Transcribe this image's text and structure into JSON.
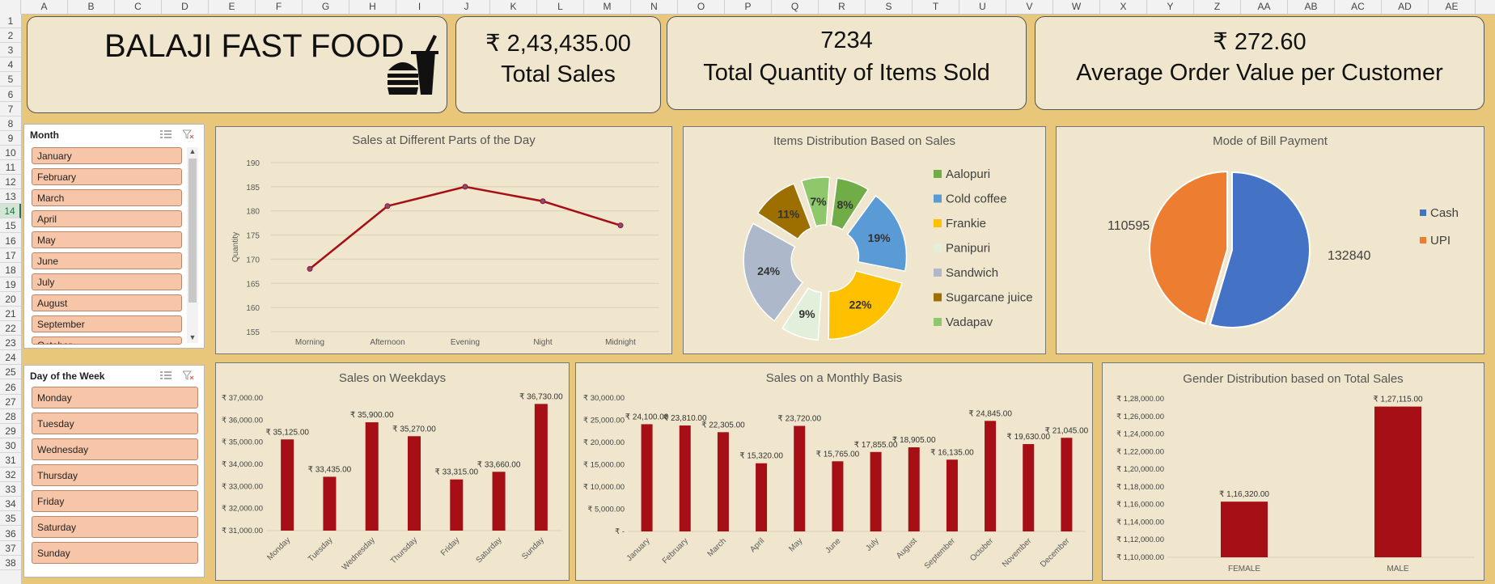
{
  "columns": [
    "A",
    "B",
    "C",
    "D",
    "E",
    "F",
    "G",
    "H",
    "I",
    "J",
    "K",
    "L",
    "M",
    "N",
    "O",
    "P",
    "Q",
    "R",
    "S",
    "T",
    "U",
    "V",
    "W",
    "X",
    "Y",
    "Z",
    "AA",
    "AB",
    "AC",
    "AD",
    "AE"
  ],
  "rows": [
    "1",
    "2",
    "3",
    "4",
    "5",
    "6",
    "7",
    "8",
    "9",
    "10",
    "11",
    "12",
    "13",
    "14",
    "15",
    "16",
    "17",
    "18",
    "19",
    "20",
    "21",
    "22",
    "23",
    "24",
    "25",
    "26",
    "27",
    "28",
    "29",
    "30",
    "31",
    "32",
    "33",
    "34",
    "35",
    "36",
    "37",
    "38"
  ],
  "kpis": {
    "title": "BALAJI FAST FOOD",
    "total_sales_value": "₹ 2,43,435.00",
    "total_sales_label": "Total Sales",
    "qty_value": "7234",
    "qty_label": "Total Quantity of Items Sold",
    "aov_value": "₹ 272.60",
    "aov_label": "Average Order Value per Customer"
  },
  "month_slicer": {
    "title": "Month",
    "items": [
      "January",
      "February",
      "March",
      "April",
      "May",
      "June",
      "July",
      "August",
      "September",
      "October"
    ]
  },
  "day_slicer": {
    "title": "Day of the Week",
    "items": [
      "Monday",
      "Tuesday",
      "Wednesday",
      "Thursday",
      "Friday",
      "Saturday",
      "Sunday"
    ]
  },
  "chart_data": [
    {
      "type": "line",
      "title": "Sales at Different Parts of the Day",
      "ylabel": "Quantity",
      "categories": [
        "Morning",
        "Afternoon",
        "Evening",
        "Night",
        "Midnight"
      ],
      "values": [
        168,
        181,
        185,
        182,
        177
      ],
      "ylim": [
        155,
        190
      ],
      "yticks": [
        "155",
        "160",
        "165",
        "170",
        "175",
        "180",
        "185",
        "190"
      ],
      "color": "#a50f15"
    },
    {
      "type": "pie",
      "title": "Items Distribution Based on Sales",
      "labels": [
        "Aalopuri",
        "Cold coffee",
        "Frankie",
        "Panipuri",
        "Sandwich",
        "Sugarcane juice",
        "Vadapav"
      ],
      "values": [
        8,
        19,
        22,
        9,
        24,
        11,
        7
      ],
      "data_labels": [
        "8%",
        "19%",
        "22%",
        "9%",
        "24%",
        "11%",
        "7%"
      ],
      "colors": [
        "#70ad47",
        "#5b9bd5",
        "#ffc000",
        "#e2efda",
        "#adb9ca",
        "#9c6f00",
        "#8fc86a"
      ],
      "legend": "right"
    },
    {
      "type": "pie",
      "title": "Mode of Bill Payment",
      "labels": [
        "Cash",
        "UPI"
      ],
      "values": [
        132840,
        110595
      ],
      "data_labels": [
        "132840",
        "110595"
      ],
      "colors": [
        "#4472c4",
        "#ed7d31"
      ],
      "legend": "right"
    },
    {
      "type": "bar",
      "title": "Sales on Weekdays",
      "categories": [
        "Monday",
        "Tuesday",
        "Wednesday",
        "Thursday",
        "Friday",
        "Saturday",
        "Sunday"
      ],
      "values": [
        35125,
        33435,
        35900,
        35270,
        33315,
        33660,
        36730
      ],
      "data_labels": [
        "₹ 35,125.00",
        "₹ 33,435.00",
        "₹ 35,900.00",
        "₹ 35,270.00",
        "₹ 33,315.00",
        "₹ 33,660.00",
        "₹ 36,730.00"
      ],
      "ylim": [
        31000,
        37000
      ],
      "yticks": [
        "₹ 31,000.00",
        "₹ 32,000.00",
        "₹ 33,000.00",
        "₹ 34,000.00",
        "₹ 35,000.00",
        "₹ 36,000.00",
        "₹ 37,000.00"
      ],
      "color": "#a50f15"
    },
    {
      "type": "bar",
      "title": "Sales on a Monthly Basis",
      "categories": [
        "January",
        "February",
        "March",
        "April",
        "May",
        "June",
        "July",
        "August",
        "September",
        "October",
        "November",
        "December"
      ],
      "values": [
        24100,
        23810,
        22305,
        15320,
        23720,
        15765,
        17855,
        18905,
        16135,
        24845,
        19630,
        21045
      ],
      "data_labels": [
        "₹ 24,100.00",
        "₹ 23,810.00",
        "₹ 22,305.00",
        "₹ 15,320.00",
        "₹ 23,720.00",
        "₹ 15,765.00",
        "₹ 17,855.00",
        "₹ 18,905.00",
        "₹ 16,135.00",
        "₹ 24,845.00",
        "₹ 19,630.00",
        "₹ 21,045.00"
      ],
      "ylim": [
        0,
        30000
      ],
      "yticks": [
        "₹ -",
        "₹ 5,000.00",
        "₹ 10,000.00",
        "₹ 15,000.00",
        "₹ 20,000.00",
        "₹ 25,000.00",
        "₹ 30,000.00"
      ],
      "color": "#a50f15"
    },
    {
      "type": "bar",
      "title": "Gender Distribution based on Total Sales",
      "categories": [
        "FEMALE",
        "MALE"
      ],
      "values": [
        116320,
        127115
      ],
      "data_labels": [
        "₹ 1,16,320.00",
        "₹ 1,27,115.00"
      ],
      "ylim": [
        110000,
        128000
      ],
      "yticks": [
        "₹ 1,10,000.00",
        "₹ 1,12,000.00",
        "₹ 1,14,000.00",
        "₹ 1,16,000.00",
        "₹ 1,18,000.00",
        "₹ 1,20,000.00",
        "₹ 1,22,000.00",
        "₹ 1,24,000.00",
        "₹ 1,26,000.00",
        "₹ 1,28,000.00"
      ],
      "color": "#a50f15"
    }
  ]
}
